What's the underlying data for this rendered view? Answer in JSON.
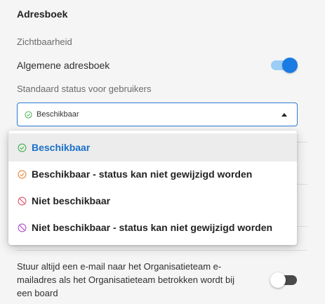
{
  "section": {
    "title": "Adresboek",
    "visibility_label": "Zichtbaarheid"
  },
  "address_book_toggle": {
    "label": "Algemene adresboek",
    "enabled": true,
    "on_color": "#1a7be3"
  },
  "default_status": {
    "label": "Standaard status voor gebruikers",
    "selected_value": "Beschikbaar",
    "options": [
      {
        "label": "Beschikbaar",
        "icon": "check-circle-icon",
        "color": "#3cb04a",
        "selected": true
      },
      {
        "label": "Beschikbaar - status kan niet gewijzigd worden",
        "icon": "check-circle-icon",
        "color": "#e8823a",
        "selected": false
      },
      {
        "label": "Niet beschikbaar",
        "icon": "block-icon",
        "color": "#e0556b",
        "selected": false
      },
      {
        "label": "Niet beschikbaar - status kan niet gewijzigd worden",
        "icon": "block-icon",
        "color": "#b14fd0",
        "selected": false
      }
    ]
  },
  "email_toggle": {
    "label": "Stuur altijd een e-mail naar het Organisatieteam e-mailadres als het Organisatieteam betrokken wordt bij een board",
    "enabled": false
  },
  "colors": {
    "accent": "#1a7be3",
    "selected_text": "#1a6fc9"
  }
}
